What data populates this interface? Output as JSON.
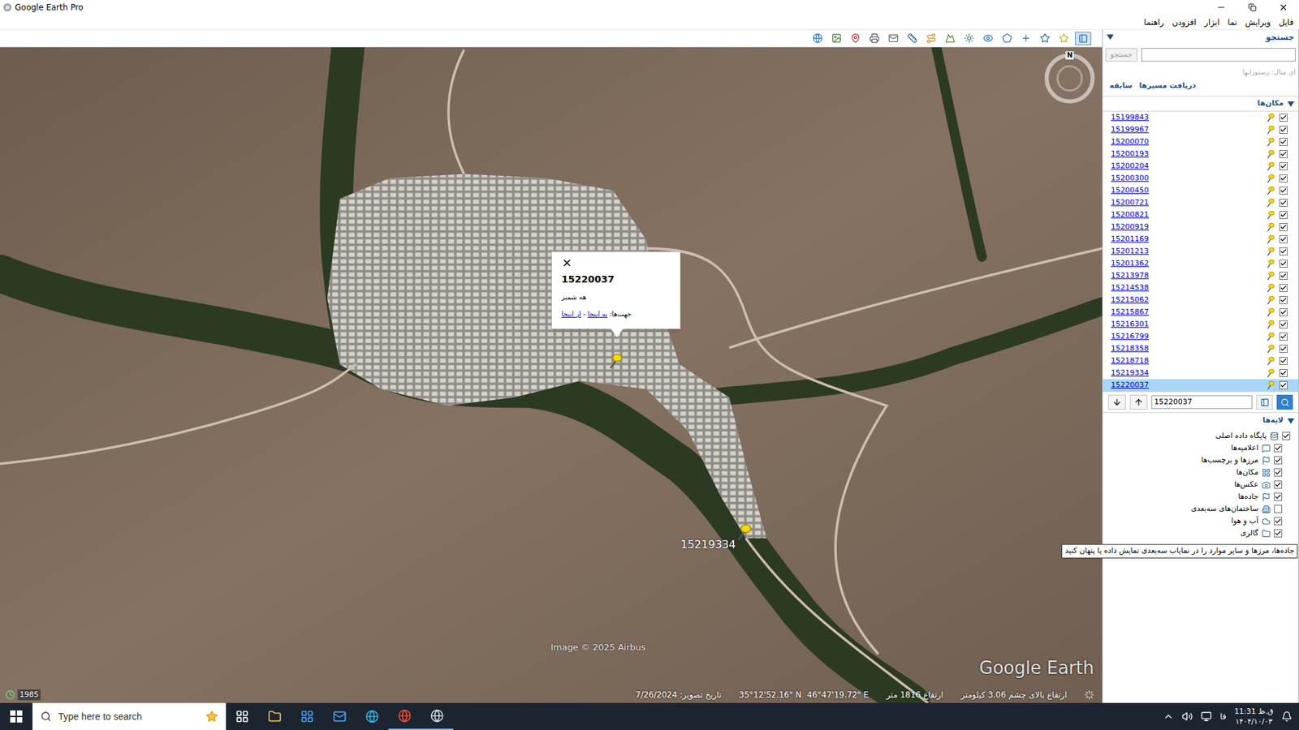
{
  "window": {
    "title": "Google Earth Pro"
  },
  "menu": [
    "فایل",
    "ویرایش",
    "نما",
    "ابزار",
    "افزودن",
    "راهنما"
  ],
  "search": {
    "header": "جستجو",
    "button": "جستجو",
    "hint": "ای مثال: رستورانها",
    "links": [
      "دریافت مسیرها",
      "سابقه"
    ]
  },
  "places": {
    "header": "مکان‌ها",
    "field": "15220037",
    "items": [
      {
        "label": "15199843",
        "checked": true,
        "selected": false
      },
      {
        "label": "15199967",
        "checked": true,
        "selected": false
      },
      {
        "label": "15200070",
        "checked": true,
        "selected": false
      },
      {
        "label": "15200193",
        "checked": true,
        "selected": false
      },
      {
        "label": "15200204",
        "checked": true,
        "selected": false
      },
      {
        "label": "15200300",
        "checked": true,
        "selected": false
      },
      {
        "label": "15200450",
        "checked": true,
        "selected": false
      },
      {
        "label": "15200721",
        "checked": true,
        "selected": false
      },
      {
        "label": "15200821",
        "checked": true,
        "selected": false
      },
      {
        "label": "15200919",
        "checked": true,
        "selected": false
      },
      {
        "label": "15201169",
        "checked": true,
        "selected": false
      },
      {
        "label": "15201213",
        "checked": true,
        "selected": false
      },
      {
        "label": "15201362",
        "checked": true,
        "selected": false
      },
      {
        "label": "15213978",
        "checked": true,
        "selected": false
      },
      {
        "label": "15214538",
        "checked": true,
        "selected": false
      },
      {
        "label": "15215062",
        "checked": true,
        "selected": false
      },
      {
        "label": "15215867",
        "checked": true,
        "selected": false
      },
      {
        "label": "15216301",
        "checked": true,
        "selected": false
      },
      {
        "label": "15216799",
        "checked": true,
        "selected": false
      },
      {
        "label": "15218358",
        "checked": true,
        "selected": false
      },
      {
        "label": "15218718",
        "checked": true,
        "selected": false
      },
      {
        "label": "15219334",
        "checked": true,
        "selected": false
      },
      {
        "label": "15220037",
        "checked": true,
        "selected": true
      }
    ]
  },
  "layers": {
    "header": "لایه‌ها",
    "items": [
      {
        "label": "پایگاه داده اصلی",
        "checked": true
      },
      {
        "label": "اعلامیه‌ها",
        "checked": true
      },
      {
        "label": "مرزها و برچسب‌ها",
        "checked": true
      },
      {
        "label": "مکان‌ها",
        "checked": true
      },
      {
        "label": "عکس‌ها",
        "checked": true
      },
      {
        "label": "جاده‌ها",
        "checked": true
      },
      {
        "label": "ساختمان‌های سه‌بعدی",
        "checked": false
      },
      {
        "label": "آب و هوا",
        "checked": true
      },
      {
        "label": "گالری",
        "checked": true
      }
    ]
  },
  "tooltip": "جاده‌ها، مرزها و سایر موارد را در نمایاب سه‌بعدی نمایش داده یا پنهان کنید",
  "map": {
    "compass": "N",
    "attribution": "Image © 2025 Airbus",
    "logo": "Google Earth",
    "history_year": "1985",
    "pins": [
      {
        "label": "15219334"
      }
    ],
    "popup": {
      "title": "15220037",
      "subtitle": "هه شمیز",
      "directions_label": "جهت‌ها:",
      "to_here": "به اینجا",
      "separator": "-",
      "from_here": "از اینجا"
    }
  },
  "status_bar": {
    "image_date": "تاریخ تصویر: 7/26/2024",
    "lat": "35°12'52.16\" N",
    "lon": "46°47'19.72\" E",
    "elevation": "ارتفاع 1816 متر",
    "eye_alt": "ارتفاع بالای چشم 3.06 کیلومتر"
  },
  "taskbar": {
    "search_placeholder": "Type here to search",
    "lang": "فا",
    "time": "ق.ظ 11:31",
    "date": "۱۴۰۴/۱۰/۰۳"
  }
}
